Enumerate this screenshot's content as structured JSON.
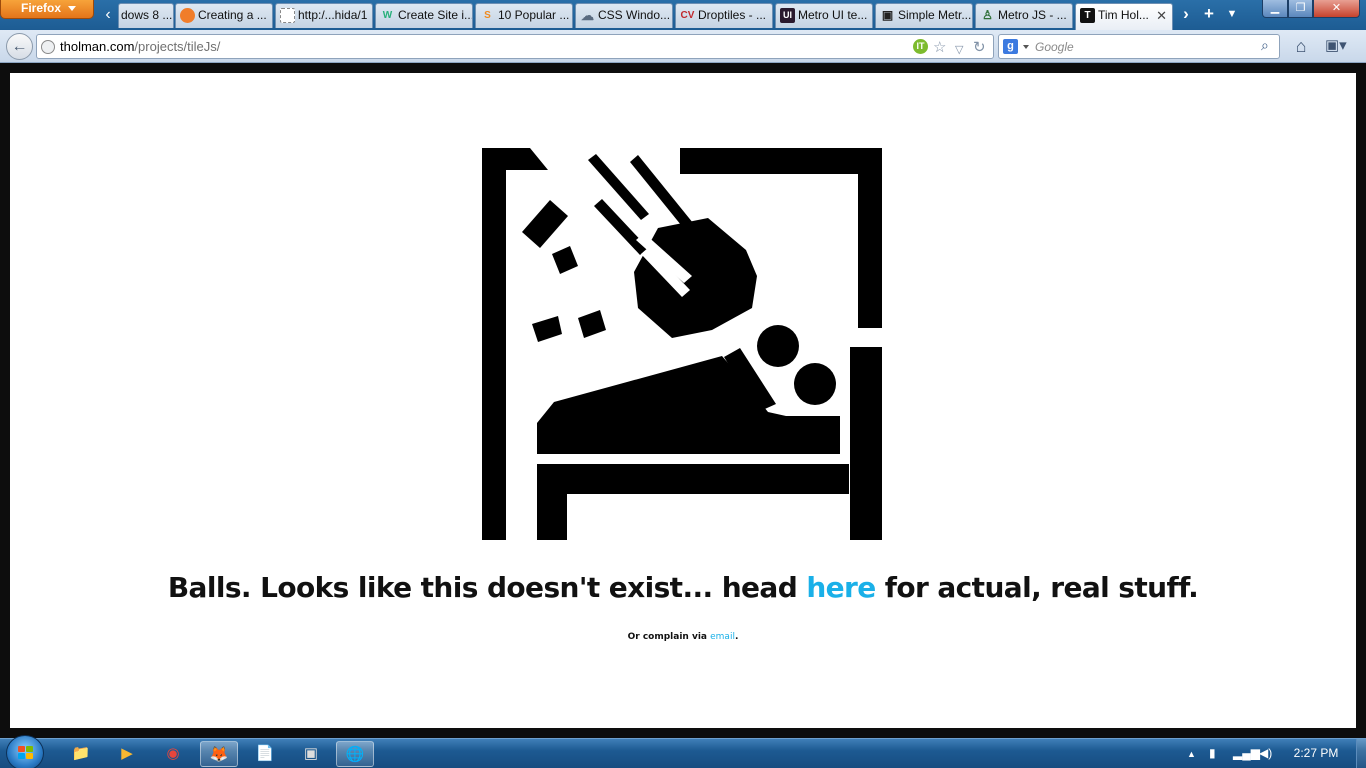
{
  "browser": {
    "menu_button": "Firefox",
    "tabs": [
      {
        "label": "dows 8 ...",
        "icon": "windows-logo",
        "icon_text": ""
      },
      {
        "label": "Creating a ...",
        "icon": "orange-circle",
        "icon_text": ""
      },
      {
        "label": "http:/...hida/1",
        "icon": "blank-page",
        "icon_text": ""
      },
      {
        "label": "Create Site i...",
        "icon": "w-logo",
        "icon_text": "W"
      },
      {
        "label": "10 Popular ...",
        "icon": "s-logo",
        "icon_text": "S"
      },
      {
        "label": "CSS Windo...",
        "icon": "cloud",
        "icon_text": ""
      },
      {
        "label": "Droptiles - ...",
        "icon": "cv-logo",
        "icon_text": "CV"
      },
      {
        "label": "Metro UI te...",
        "icon": "ui-logo",
        "icon_text": "UI"
      },
      {
        "label": "Simple Metr...",
        "icon": "camera",
        "icon_text": ""
      },
      {
        "label": "Metro JS - ...",
        "icon": "person",
        "icon_text": ""
      },
      {
        "label": "Tim Hol...",
        "icon": "t-logo",
        "icon_text": "T",
        "active": true
      }
    ],
    "url": {
      "host": "tholman.com",
      "path": "/projects/tileJs/"
    },
    "search": {
      "placeholder": "Google",
      "engine_letter": "g"
    }
  },
  "page": {
    "headline": {
      "before": "Balls. Looks like this doesn't exist... head ",
      "link": "here",
      "after": " for actual, real stuff."
    },
    "subline": {
      "before": "Or complain via ",
      "link": "email",
      "after": "."
    },
    "link_color": "#1ab0e8"
  },
  "taskbar": {
    "clock": "2:27 PM",
    "apps": [
      {
        "name": "explorer",
        "glyph": "📁"
      },
      {
        "name": "media-player",
        "glyph": "▶"
      },
      {
        "name": "chrome",
        "glyph": "◉"
      },
      {
        "name": "firefox",
        "glyph": "🦊",
        "active": true
      },
      {
        "name": "notepad",
        "glyph": "📄"
      },
      {
        "name": "terminal",
        "glyph": "▣"
      },
      {
        "name": "network-app",
        "glyph": "🌐"
      }
    ]
  }
}
